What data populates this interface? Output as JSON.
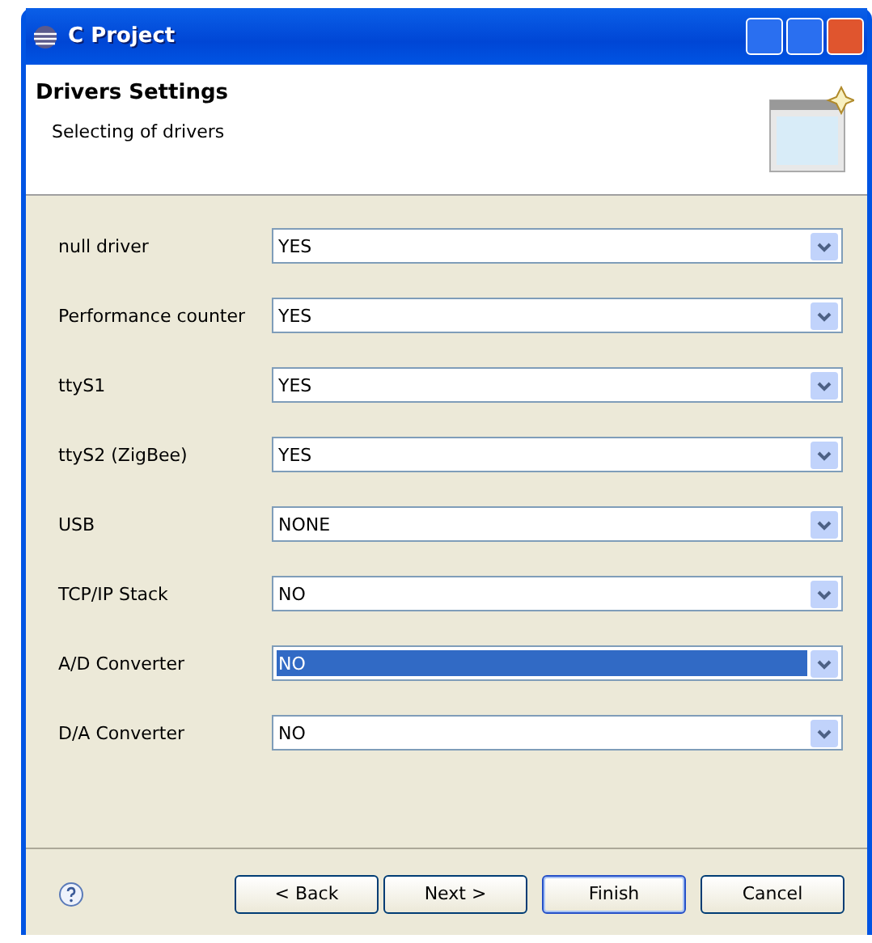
{
  "window": {
    "title": "C Project"
  },
  "header": {
    "title": "Drivers Settings",
    "subtitle": "Selecting of drivers"
  },
  "drivers": [
    {
      "label": "null driver",
      "value": "YES",
      "selected": false
    },
    {
      "label": "Performance counter",
      "value": "YES",
      "selected": false
    },
    {
      "label": "ttyS1",
      "value": "YES",
      "selected": false
    },
    {
      "label": "ttyS2 (ZigBee)",
      "value": "YES",
      "selected": false
    },
    {
      "label": "USB",
      "value": "NONE",
      "selected": false
    },
    {
      "label": "TCP/IP Stack",
      "value": "NO",
      "selected": false
    },
    {
      "label": "A/D Converter",
      "value": "NO",
      "selected": true
    },
    {
      "label": "D/A Converter",
      "value": "NO",
      "selected": false
    }
  ],
  "buttons": [
    {
      "label": "< Back",
      "default": false
    },
    {
      "label": "Next >",
      "default": false
    },
    {
      "label": "Finish",
      "default": true
    },
    {
      "label": "Cancel",
      "default": false
    }
  ]
}
